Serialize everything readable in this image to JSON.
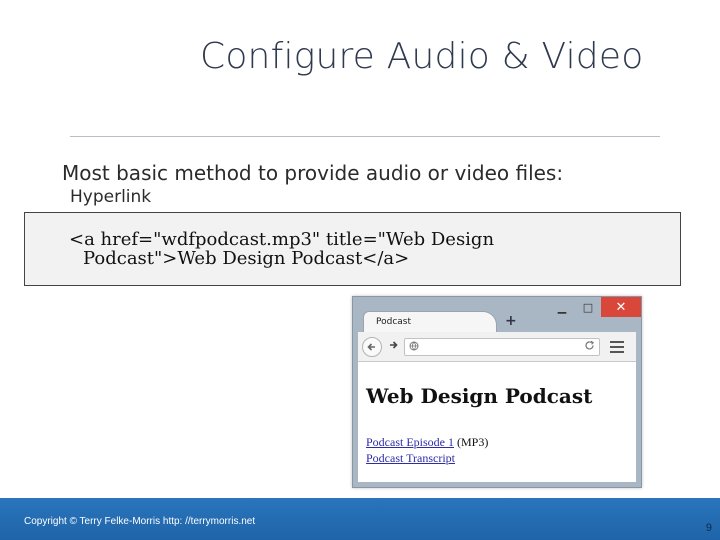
{
  "slide": {
    "title": "Configure Audio & Video",
    "bullet_main": "Most basic method to provide audio or video files:",
    "bullet_sub": "Hyperlink",
    "code_lines": [
      "<a href=\"wdfpodcast.mp3\" title=\"Web Design",
      "Podcast\">Web Design Podcast</a>"
    ]
  },
  "browser": {
    "tab_title": "Podcast",
    "new_tab_glyph": "+",
    "window_buttons": {
      "minimize": "▁",
      "maximize": "□",
      "close": "✕"
    },
    "icons": {
      "back": "back-arrow-icon",
      "forward": "forward-arrow-icon",
      "globe": "globe-icon",
      "reload": "reload-icon",
      "menu": "hamburger-menu-icon"
    },
    "page": {
      "heading": "Web Design Podcast",
      "link1": "Podcast Episode 1",
      "link1_suffix": " (MP3)",
      "link2": "Podcast Transcript"
    }
  },
  "footer": {
    "copyright": "Copyright © Terry Felke-Morris http: //terrymorris.net",
    "slide_number": "9"
  },
  "colors": {
    "title": "#2f3a4f",
    "footer_bar": "#2a75bd",
    "close_button": "#d9473b",
    "link": "#2d2ba6"
  }
}
